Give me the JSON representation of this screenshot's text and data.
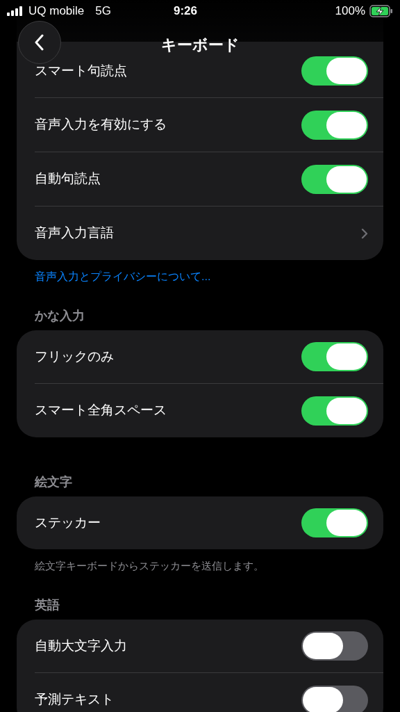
{
  "status_bar": {
    "carrier": "UQ mobile",
    "network": "5G",
    "time": "9:26",
    "battery": "100%",
    "charging": true
  },
  "nav": {
    "title": "キーボード"
  },
  "sections": [
    {
      "rows": [
        {
          "label": "スマート句読点",
          "kind": "toggle",
          "on": true
        },
        {
          "label": "音声入力を有効にする",
          "kind": "toggle",
          "on": true
        },
        {
          "label": "自動句読点",
          "kind": "toggle",
          "on": true
        },
        {
          "label": "音声入力言語",
          "kind": "link"
        }
      ],
      "footer": {
        "kind": "link",
        "text": "音声入力とプライバシーについて..."
      }
    },
    {
      "header": "かな入力",
      "rows": [
        {
          "label": "フリックのみ",
          "kind": "toggle",
          "on": true
        },
        {
          "label": "スマート全角スペース",
          "kind": "toggle",
          "on": true
        }
      ]
    },
    {
      "header": "絵文字",
      "rows": [
        {
          "label": "ステッカー",
          "kind": "toggle",
          "on": true
        }
      ],
      "footer": {
        "kind": "note",
        "text": "絵文字キーボードからステッカーを送信します。"
      }
    },
    {
      "header": "英語",
      "rows": [
        {
          "label": "自動大文字入力",
          "kind": "toggle",
          "on": false
        },
        {
          "label": "予測テキスト",
          "kind": "toggle",
          "on": false
        }
      ]
    }
  ]
}
